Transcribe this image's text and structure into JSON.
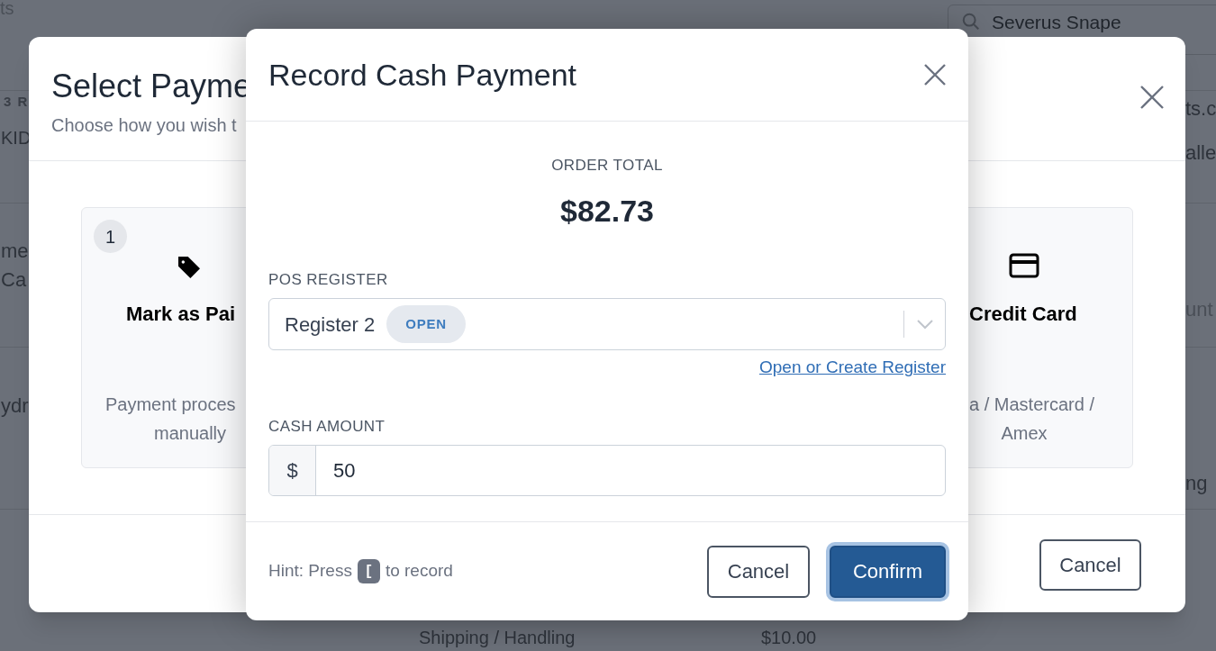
{
  "background_page": {
    "search": {
      "value": "Severus Snape"
    },
    "fragments": [
      "ts",
      "3 R",
      "KID",
      "me",
      "Ca",
      "ydr",
      "ts.c",
      "alle",
      "unt",
      "ng",
      "Shipping / Handling",
      "$10.00"
    ]
  },
  "payment_modal": {
    "title": "Select Payme",
    "subtitle": "Choose how you wish t",
    "options": [
      {
        "kind": "tag",
        "number": "1",
        "title": "Mark as Pai",
        "description": [
          "Payment proces",
          "manually"
        ]
      },
      {
        "kind": "card",
        "title": "Credit Card",
        "description": [
          "a / Mastercard /",
          "Amex"
        ]
      }
    ],
    "cancel": "Cancel"
  },
  "cash_modal": {
    "title": "Record Cash Payment",
    "order_total_label": "ORDER TOTAL",
    "order_total": "$82.73",
    "register": {
      "label": "POS REGISTER",
      "value": "Register 2",
      "badge": "OPEN"
    },
    "register_link": "Open or Create Register",
    "cash": {
      "label": "CASH AMOUNT",
      "prefix": "$",
      "value": "50"
    },
    "hint": {
      "before": "Hint: Press",
      "key": "[",
      "after": "to record"
    },
    "buttons": [
      {
        "label": "Cancel",
        "kind": "secondary",
        "focused": false
      },
      {
        "label": "Confirm",
        "kind": "primary",
        "focused": true
      }
    ]
  }
}
